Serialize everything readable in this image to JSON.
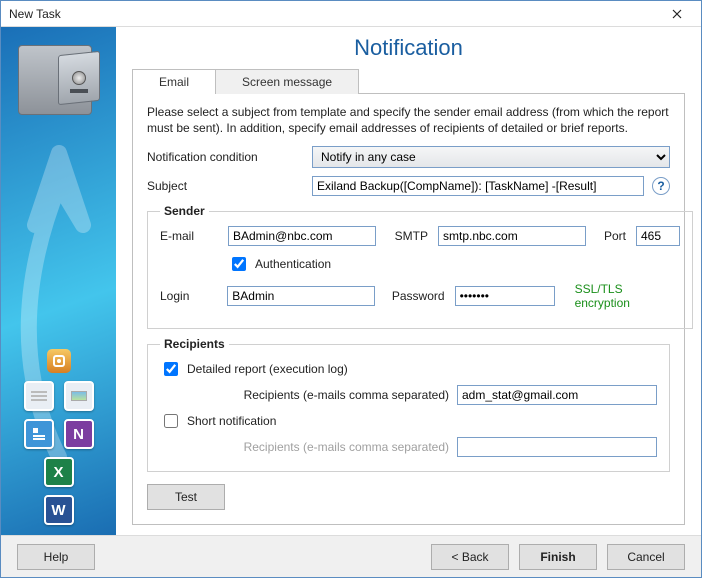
{
  "window": {
    "title": "New Task"
  },
  "page": {
    "title": "Notification"
  },
  "tabs": {
    "email": "Email",
    "screen": "Screen message"
  },
  "instructions": "Please select a subject from template and specify the sender email address (from which the report must be sent). In addition, specify email addresses of recipients of detailed or brief reports.",
  "condition": {
    "label": "Notification condition",
    "value": "Notify in any case"
  },
  "subject": {
    "label": "Subject",
    "value": "Exiland Backup([CompName]): [TaskName] -[Result]"
  },
  "sender": {
    "legend": "Sender",
    "email_label": "E-mail",
    "email": "BAdmin@nbc.com",
    "smtp_label": "SMTP",
    "smtp": "smtp.nbc.com",
    "port_label": "Port",
    "port": "465",
    "auth_label": "Authentication",
    "auth_checked": true,
    "login_label": "Login",
    "login": "BAdmin",
    "password_label": "Password",
    "password": "•••••••",
    "ssl_text": "SSL/TLS encryption"
  },
  "recipients": {
    "legend": "Recipients",
    "detailed_label": "Detailed report (execution log)",
    "detailed_checked": true,
    "recips_label": "Recipients (e-mails comma separated)",
    "detailed_emails": "adm_stat@gmail.com",
    "short_label": "Short notification",
    "short_checked": false,
    "short_emails": ""
  },
  "buttons": {
    "test": "Test",
    "help": "Help",
    "back": "<  Back",
    "finish": "Finish",
    "cancel": "Cancel"
  },
  "sidebar_icons": {
    "folder": "folder-icon",
    "doc": "document-icon",
    "photo": "photo-icon",
    "contact": "contacts-icon",
    "onenote": "onenote-icon",
    "excel": "excel-icon",
    "word": "word-icon"
  }
}
